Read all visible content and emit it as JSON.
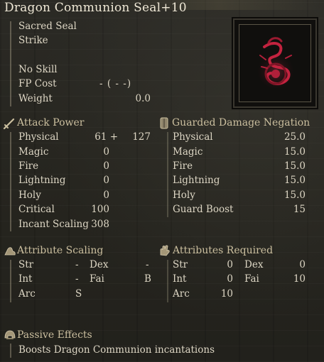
{
  "title": "Dragon Communion Seal+10",
  "info": {
    "category": "Sacred Seal",
    "attack_type": "Strike",
    "skill": "No Skill",
    "fp_cost_label": "FP Cost",
    "fp_cost_value": "- (      -      -)",
    "weight_label": "Weight",
    "weight_value": "0.0"
  },
  "attack_power": {
    "header": "Attack Power",
    "rows": [
      {
        "label": "Physical",
        "v1": "61 +",
        "v2": "127"
      },
      {
        "label": "Magic",
        "v1": "0",
        "v2": ""
      },
      {
        "label": "Fire",
        "v1": "0",
        "v2": ""
      },
      {
        "label": "Lightning",
        "v1": "0",
        "v2": ""
      },
      {
        "label": "Holy",
        "v1": "0",
        "v2": ""
      },
      {
        "label": "Critical",
        "v1": "100",
        "v2": ""
      },
      {
        "label": "Incant Scaling",
        "v1": "308",
        "v2": ""
      }
    ]
  },
  "guarded": {
    "header": "Guarded Damage Negation",
    "rows": [
      {
        "label": "Physical",
        "value": "25.0"
      },
      {
        "label": "Magic",
        "value": "15.0"
      },
      {
        "label": "Fire",
        "value": "15.0"
      },
      {
        "label": "Lightning",
        "value": "15.0"
      },
      {
        "label": "Holy",
        "value": "15.0"
      },
      {
        "label": "Guard Boost",
        "value": "15"
      }
    ]
  },
  "attribute_scaling": {
    "header": "Attribute Scaling",
    "rows": [
      {
        "a": "Str",
        "av": "-",
        "b": "Dex",
        "bv": "-"
      },
      {
        "a": "Int",
        "av": "-",
        "b": "Fai",
        "bv": "B"
      },
      {
        "a": "Arc",
        "av": "S",
        "b": "",
        "bv": ""
      }
    ]
  },
  "attributes_required": {
    "header": "Attributes Required",
    "rows": [
      {
        "a": "Str",
        "av": "0",
        "b": "Dex",
        "bv": "0"
      },
      {
        "a": "Int",
        "av": "0",
        "b": "Fai",
        "bv": "10"
      },
      {
        "a": "Arc",
        "av": "10",
        "b": "",
        "bv": ""
      }
    ]
  },
  "passive": {
    "header": "Passive Effects",
    "text": "Boosts Dragon Communion incantations"
  },
  "icons": {
    "attack": "sword-icon",
    "guard": "shield-icon",
    "scaling": "flexed-arm-icon",
    "required": "hand-icon",
    "passive": "helmet-icon",
    "item": "dragon-seal-icon"
  },
  "colors": {
    "accent": "#cbbf9f",
    "text": "#ddd6c4",
    "seal_red": "#b0203a"
  }
}
